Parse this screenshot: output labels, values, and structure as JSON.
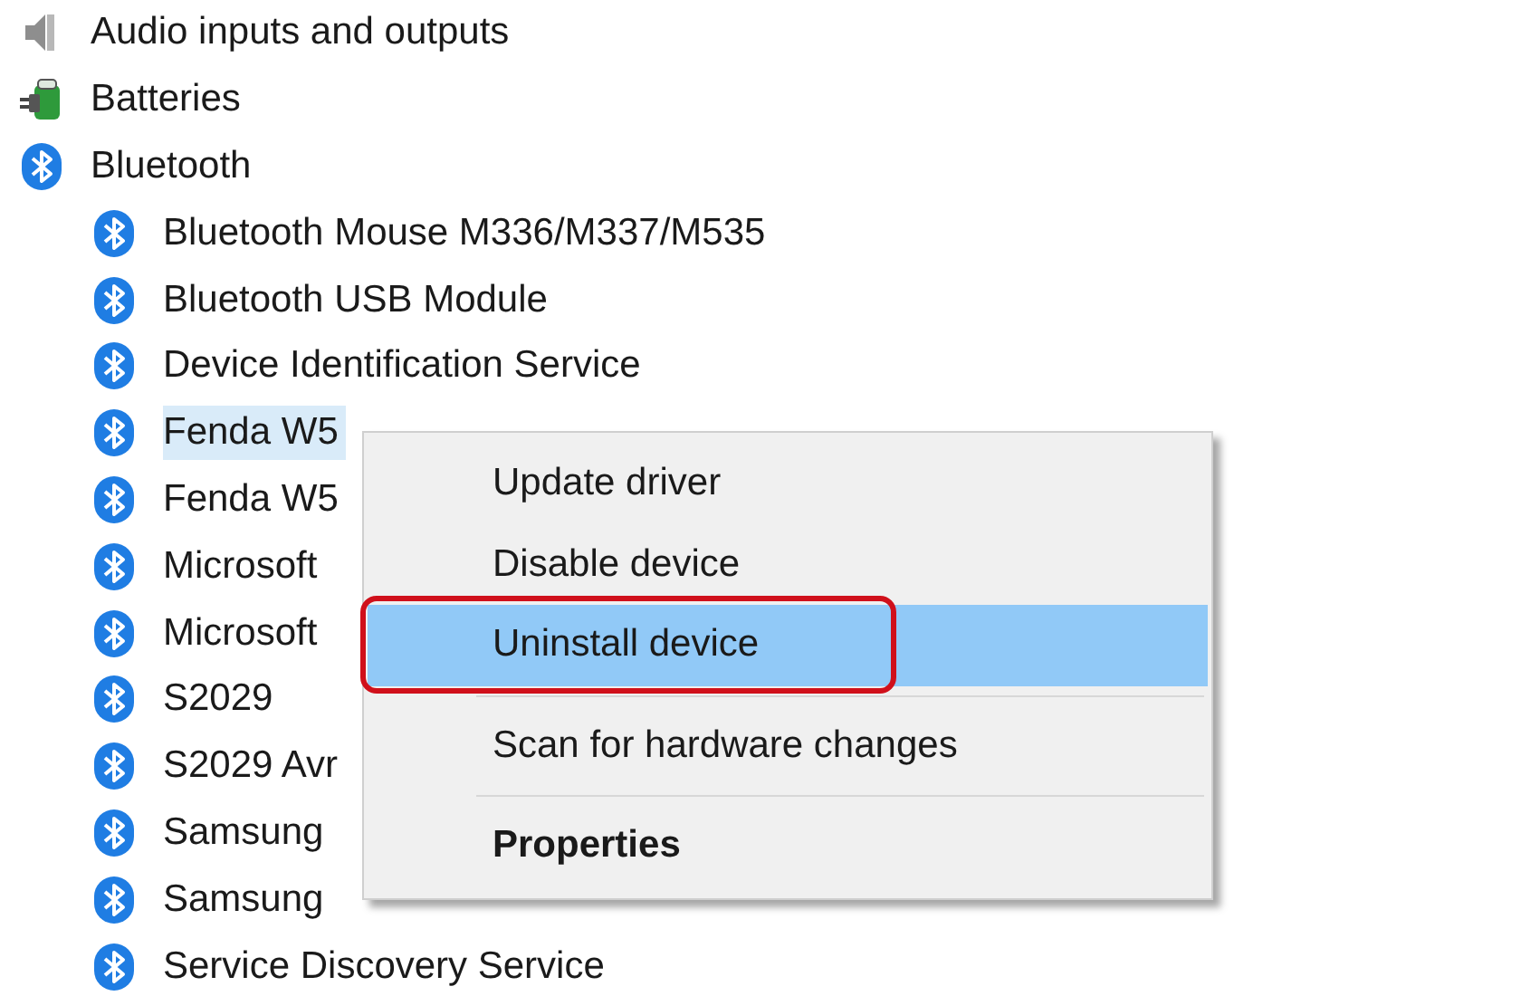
{
  "tree": [
    {
      "label": "Audio inputs and outputs",
      "selected": false
    },
    {
      "label": "Batteries",
      "selected": false
    },
    {
      "label": "Bluetooth",
      "selected": false,
      "children": [
        {
          "label": "Bluetooth Mouse M336/M337/M535",
          "selected": false
        },
        {
          "label": "Bluetooth USB Module",
          "selected": false
        },
        {
          "label": "Device Identification Service",
          "selected": false
        },
        {
          "label": "Fenda W5",
          "selected": true
        },
        {
          "label": "Fenda W5",
          "selected": false
        },
        {
          "label": "Microsoft",
          "selected": false
        },
        {
          "label": "Microsoft",
          "selected": false
        },
        {
          "label": "S2029",
          "selected": false
        },
        {
          "label": "S2029 Avr",
          "selected": false
        },
        {
          "label": "Samsung",
          "selected": false
        },
        {
          "label": "Samsung",
          "selected": false
        },
        {
          "label": "Service Discovery Service",
          "selected": false
        }
      ]
    }
  ],
  "context_menu": [
    {
      "kind": "item",
      "label": "Update driver",
      "selected": false,
      "bold": false,
      "outlined": false
    },
    {
      "kind": "item",
      "label": "Disable device",
      "selected": false,
      "bold": false,
      "outlined": false
    },
    {
      "kind": "item",
      "label": "Uninstall device",
      "selected": true,
      "bold": false,
      "outlined": true
    },
    {
      "kind": "separator"
    },
    {
      "kind": "item",
      "label": "Scan for hardware changes",
      "selected": false,
      "bold": false,
      "outlined": false
    },
    {
      "kind": "separator"
    },
    {
      "kind": "item",
      "label": "Properties",
      "selected": false,
      "bold": true,
      "outlined": false
    }
  ]
}
